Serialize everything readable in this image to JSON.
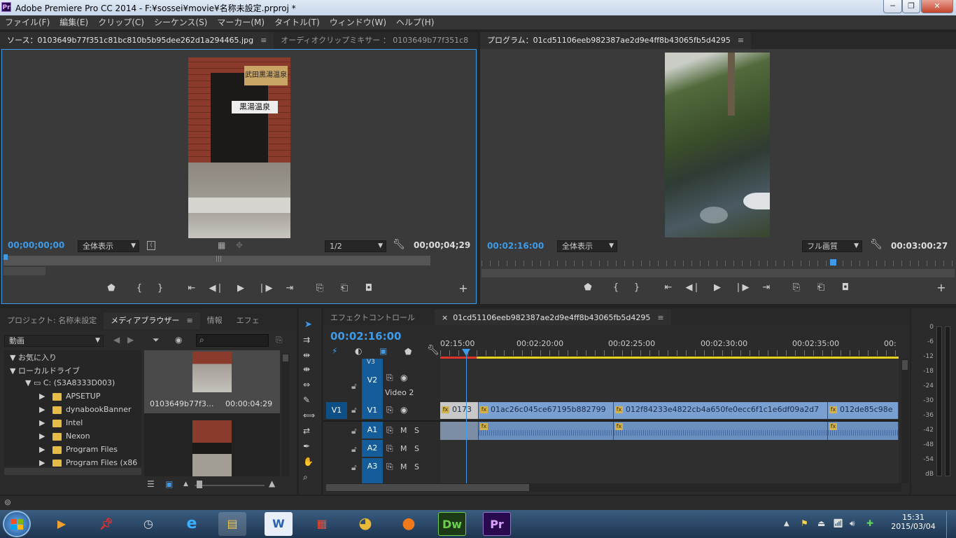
{
  "window": {
    "app_icon": "Pr",
    "title": "Adobe Premiere Pro CC 2014 - F:¥sossei¥movie¥名称未設定.prproj *",
    "minimize": "─",
    "maximize": "❐",
    "close": "✕"
  },
  "menu": [
    "ファイル(F)",
    "編集(E)",
    "クリップ(C)",
    "シーケンス(S)",
    "マーカー(M)",
    "タイトル(T)",
    "ウィンドウ(W)",
    "ヘルプ(H)"
  ],
  "source": {
    "tab": "ソース：0103649b77f351c81bc810b5b95dee262d1a294465.jpg",
    "tab2": "オーディオクリップミキサー ： 0103649b77f351c8",
    "timecode_in": "00;00;00;00",
    "zoom": "全体表示",
    "resolution": "1/2",
    "duration": "00;00;04;29",
    "sign_text": "黒湯温泉",
    "sign_top": "武田黒湯温泉"
  },
  "program": {
    "tab": "プログラム：01cd51106eeb982387ae2d9e4ff8b43065fb5d4295",
    "timecode": "00:02:16:00",
    "zoom": "全体表示",
    "quality": "フル画質",
    "duration": "00:03:00:27"
  },
  "transport": {
    "marker": "⬟",
    "in": "{",
    "out": "}",
    "go_in": "⇤",
    "step_back": "◀❘",
    "play": "▶",
    "step_fwd": "❘▶",
    "go_out": "⇥",
    "insert": "⎘",
    "overwrite": "⎗",
    "export": "◘",
    "add": "+"
  },
  "project": {
    "tabs": [
      "プロジェクト: 名称未設定",
      "メディアブラウザー",
      "情報",
      "エフェ"
    ],
    "filter": "動画",
    "favorites": "お気に入り",
    "local": "ローカルドライブ",
    "drive": "C: (S3A8333D003)",
    "folders": [
      "APSETUP",
      "dynabookBanner",
      "Intel",
      "Nexon",
      "Program Files",
      "Program Files (x86"
    ],
    "clip_name": "0103649b77f3...",
    "clip_dur": "00:00:04:29"
  },
  "timeline": {
    "tab_effect": "エフェクトコントロール",
    "tab_seq": "01cd51106eeb982387ae2d9e4ff8b43065fb5d4295",
    "close": "×",
    "timecode": "00:02:16:00",
    "ruler": [
      "02:15:00",
      "00:02:20:00",
      "00:02:25:00",
      "00:02:30:00",
      "00:02:35:00",
      "00:"
    ],
    "tracks": {
      "v3": "V3",
      "v2": "V2",
      "v2name": "Video 2",
      "v1src": "V1",
      "v1": "V1",
      "a1": "A1",
      "a2": "A2",
      "a3": "A3",
      "m": "M",
      "s": "S"
    },
    "clips": [
      "0173",
      "01ac26c045ce67195b882799",
      "012f84233e4822cb4a650fe0ecc6f1c1e6df09a2d7",
      "012de85c98e"
    ],
    "fx": "fx"
  },
  "meter": {
    "labels": [
      "0",
      "-6",
      "-12",
      "-18",
      "-24",
      "-30",
      "-36",
      "-42",
      "-48",
      "-54",
      "dB"
    ]
  },
  "clock": {
    "time": "15:31",
    "date": "2015/03/04"
  },
  "colors": {
    "accent": "#3d9be9",
    "target": "#155c9a",
    "clip": "#7aa0d2",
    "playhead": "#3d9be9"
  }
}
